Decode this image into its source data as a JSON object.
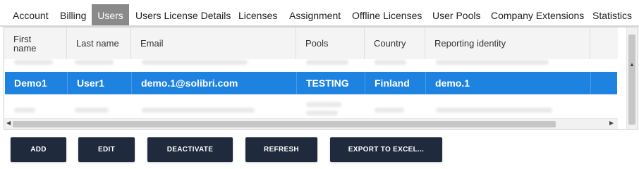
{
  "tabs": [
    "Account",
    "Billing",
    "Users",
    "Users License Details",
    "Licenses",
    "Assignment",
    "Offline Licenses",
    "User Pools",
    "Company Extensions",
    "Statistics"
  ],
  "active_tab": "Users",
  "table": {
    "columns": [
      "First name",
      "Last name",
      "Email",
      "Pools",
      "Country",
      "Reporting identity"
    ],
    "selected_row": [
      "Demo1",
      "User1",
      "demo.1@solibri.com",
      "TESTING",
      "Finland",
      "demo.1"
    ]
  },
  "buttons": [
    "ADD",
    "EDIT",
    "DEACTIVATE",
    "REFRESH",
    "EXPORT TO EXCEL..."
  ],
  "colors": {
    "selected_row": "#1e82e0",
    "button_bg": "#1f2a3c",
    "active_tab": "#8a8a8a"
  },
  "icons": {
    "scroll_up": "triangle-up-icon",
    "scroll_left": "triangle-left-icon",
    "scroll_right": "triangle-right-icon"
  }
}
